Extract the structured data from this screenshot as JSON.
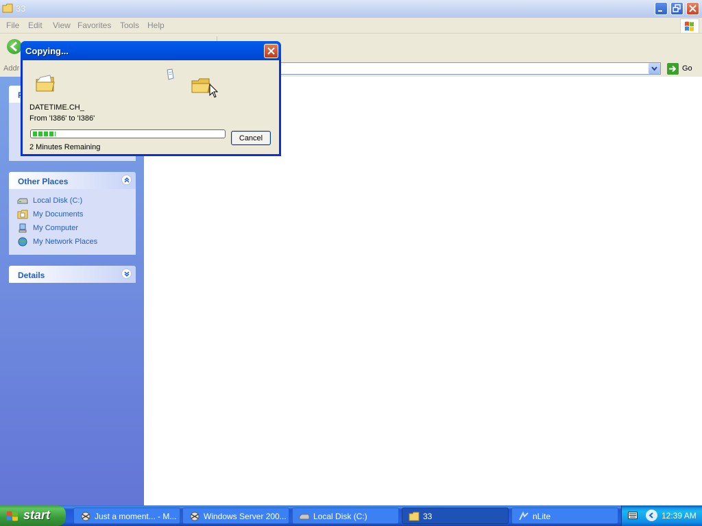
{
  "window": {
    "title": "33"
  },
  "menu": [
    "File",
    "Edit",
    "View",
    "Favorites",
    "Tools",
    "Help"
  ],
  "address": {
    "label": "Addr",
    "go_label": "Go"
  },
  "task_pane": {
    "top_panel_letter": "F",
    "other_places": {
      "title": "Other Places",
      "items": [
        {
          "label": "Local Disk (C:)",
          "icon": "drive-icon"
        },
        {
          "label": "My Documents",
          "icon": "my-documents-icon"
        },
        {
          "label": "My Computer",
          "icon": "my-computer-icon"
        },
        {
          "label": "My Network Places",
          "icon": "network-places-icon"
        }
      ]
    },
    "details": {
      "title": "Details"
    }
  },
  "dialog": {
    "title": "Copying...",
    "file_name": "DATETIME.CH_",
    "from_to": "From 'I386' to 'I386'",
    "remaining": "2 Minutes Remaining",
    "progress": 0.12,
    "cancel_label": "Cancel"
  },
  "taskbar": {
    "start_label": "start",
    "buttons": [
      {
        "label": "Just a moment... - M...",
        "icon": "browser-icon",
        "active": false
      },
      {
        "label": "Windows Server 200...",
        "icon": "browser-icon",
        "active": false
      },
      {
        "label": "Local Disk (C:)",
        "icon": "drive-icon",
        "active": false
      },
      {
        "label": "33",
        "icon": "folder-icon",
        "active": true
      },
      {
        "label": "nLite",
        "icon": "nlite-icon",
        "active": false
      }
    ],
    "clock": "12:39 AM"
  },
  "colors": {
    "link_blue": "#215dc6",
    "xp_blue": "#0055e5",
    "progress_green": "#2ec32e"
  }
}
